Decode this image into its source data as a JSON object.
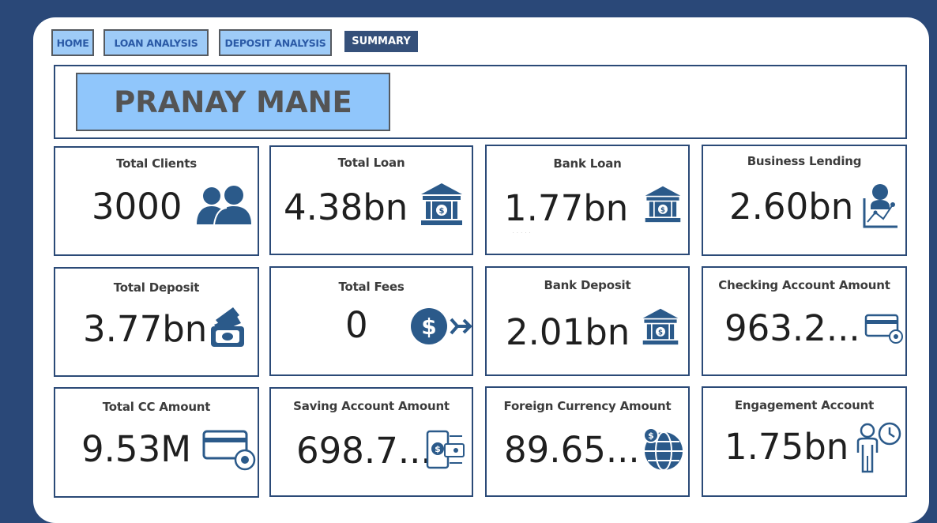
{
  "nav": {
    "home": "HOME",
    "loan_analysis": "LOAN ANALYSIS",
    "deposit_analysis": "DEPOSIT ANALYSIS",
    "summary": "SUMMARY"
  },
  "header": {
    "name": "PRANAY MANE"
  },
  "cards": {
    "total_clients": {
      "title": "Total Clients",
      "value": "3000",
      "icon": "users-icon"
    },
    "total_loan": {
      "title": "Total Loan",
      "value": "4.38bn",
      "icon": "bank-icon"
    },
    "bank_loan": {
      "title": "Bank Loan",
      "value": "1.77bn",
      "icon": "bank-icon"
    },
    "business_lending": {
      "title": "Business Lending",
      "value": "2.60bn",
      "icon": "person-chart-icon"
    },
    "total_deposit": {
      "title": "Total Deposit",
      "value": "3.77bn",
      "icon": "cash-stack-icon"
    },
    "total_fees": {
      "title": "Total Fees",
      "value": "0",
      "icon": "dollar-transfer-icon"
    },
    "bank_deposit": {
      "title": "Bank Deposit",
      "value": "2.01bn",
      "icon": "bank-icon"
    },
    "checking_account_amount": {
      "title": "Checking Account Amount",
      "value": "963.2...",
      "icon": "card-gear-icon"
    },
    "total_cc_amount": {
      "title": "Total CC Amount",
      "value": "9.53M",
      "icon": "card-gear-icon"
    },
    "saving_account_amount": {
      "title": "Saving Account Amount",
      "value": "698.7...",
      "icon": "mobile-payment-icon"
    },
    "foreign_currency_amount": {
      "title": "Foreign Currency Amount",
      "value": "89.65...",
      "icon": "globe-dollar-icon"
    },
    "engagement_account": {
      "title": "Engagement Account",
      "value": "1.75bn",
      "icon": "person-clock-icon"
    }
  },
  "colors": {
    "background": "#2a4878",
    "accent": "#2b5a8a",
    "nav_button": "#9ecbf7",
    "name_box": "#90c6fb",
    "summary_button": "#35507a"
  }
}
